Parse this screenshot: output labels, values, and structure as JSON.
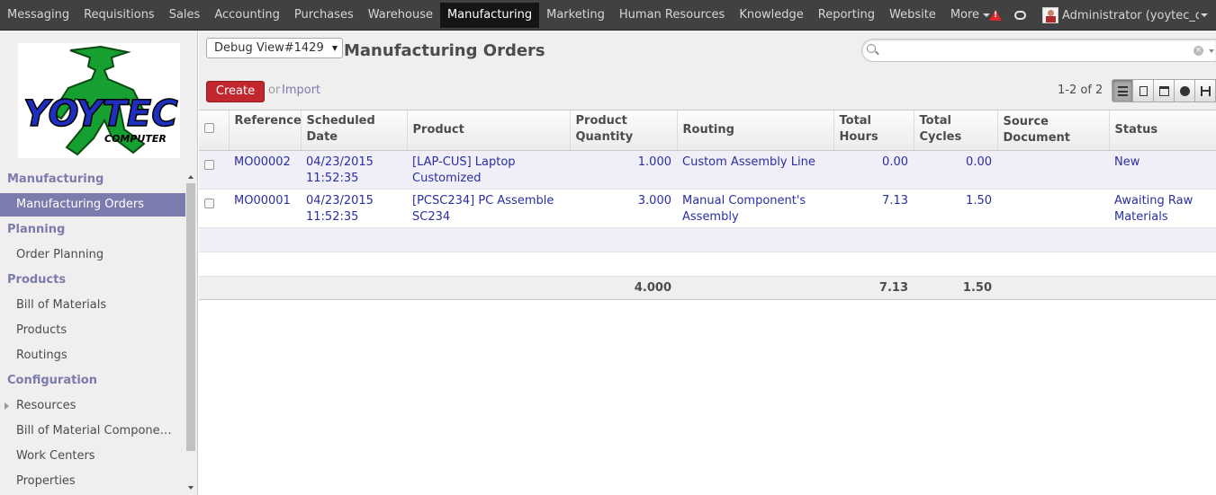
{
  "topbar": {
    "menu": [
      "Messaging",
      "Requisitions",
      "Sales",
      "Accounting",
      "Purchases",
      "Warehouse",
      "Manufacturing",
      "Marketing",
      "Human Resources",
      "Knowledge",
      "Reporting",
      "Website",
      "More"
    ],
    "active": "Manufacturing",
    "user": "Administrator (yoytec_d..."
  },
  "logo": {
    "line1": "YOYTEC",
    "line2": "COMPUTER"
  },
  "sidebar": {
    "sections": [
      {
        "title": "Manufacturing",
        "items": [
          "Manufacturing Orders"
        ]
      },
      {
        "title": "Planning",
        "items": [
          "Order Planning"
        ]
      },
      {
        "title": "Products",
        "items": [
          "Bill of Materials",
          "Products",
          "Routings"
        ]
      },
      {
        "title": "Configuration",
        "items": [
          "Resources",
          "Bill of Material Compone…",
          "Work Centers",
          "Properties"
        ]
      }
    ]
  },
  "header": {
    "debug": "Debug View#1429",
    "title": "Manufacturing Orders",
    "search_placeholder": "",
    "create": "Create",
    "or": "or",
    "import": "Import",
    "pager": "1-2 of 2"
  },
  "table": {
    "columns": [
      "Reference",
      "Scheduled Date",
      "Product",
      "Product Quantity",
      "Routing",
      "Total Hours",
      "Total Cycles",
      "Source Document",
      "Status"
    ],
    "rows": [
      {
        "reference": "MO00002",
        "date": "04/23/2015 11:52:35",
        "product": "[LAP-CUS] Laptop Customized",
        "quantity": "1.000",
        "routing": "Custom Assembly Line",
        "hours": "0.00",
        "cycles": "0.00",
        "source": "",
        "status": "New"
      },
      {
        "reference": "MO00001",
        "date": "04/23/2015 11:52:35",
        "product": "[PCSC234] PC Assemble SC234",
        "quantity": "3.000",
        "routing": "Manual Component's Assembly",
        "hours": "7.13",
        "cycles": "1.50",
        "source": "",
        "status": "Awaiting Raw Materials"
      }
    ],
    "totals": {
      "quantity": "4.000",
      "hours": "7.13",
      "cycles": "1.50"
    }
  },
  "colors": {
    "topbar": "#414141",
    "accent": "#7c7bad",
    "create": "#c1272c",
    "link": "#2a2fa0"
  }
}
